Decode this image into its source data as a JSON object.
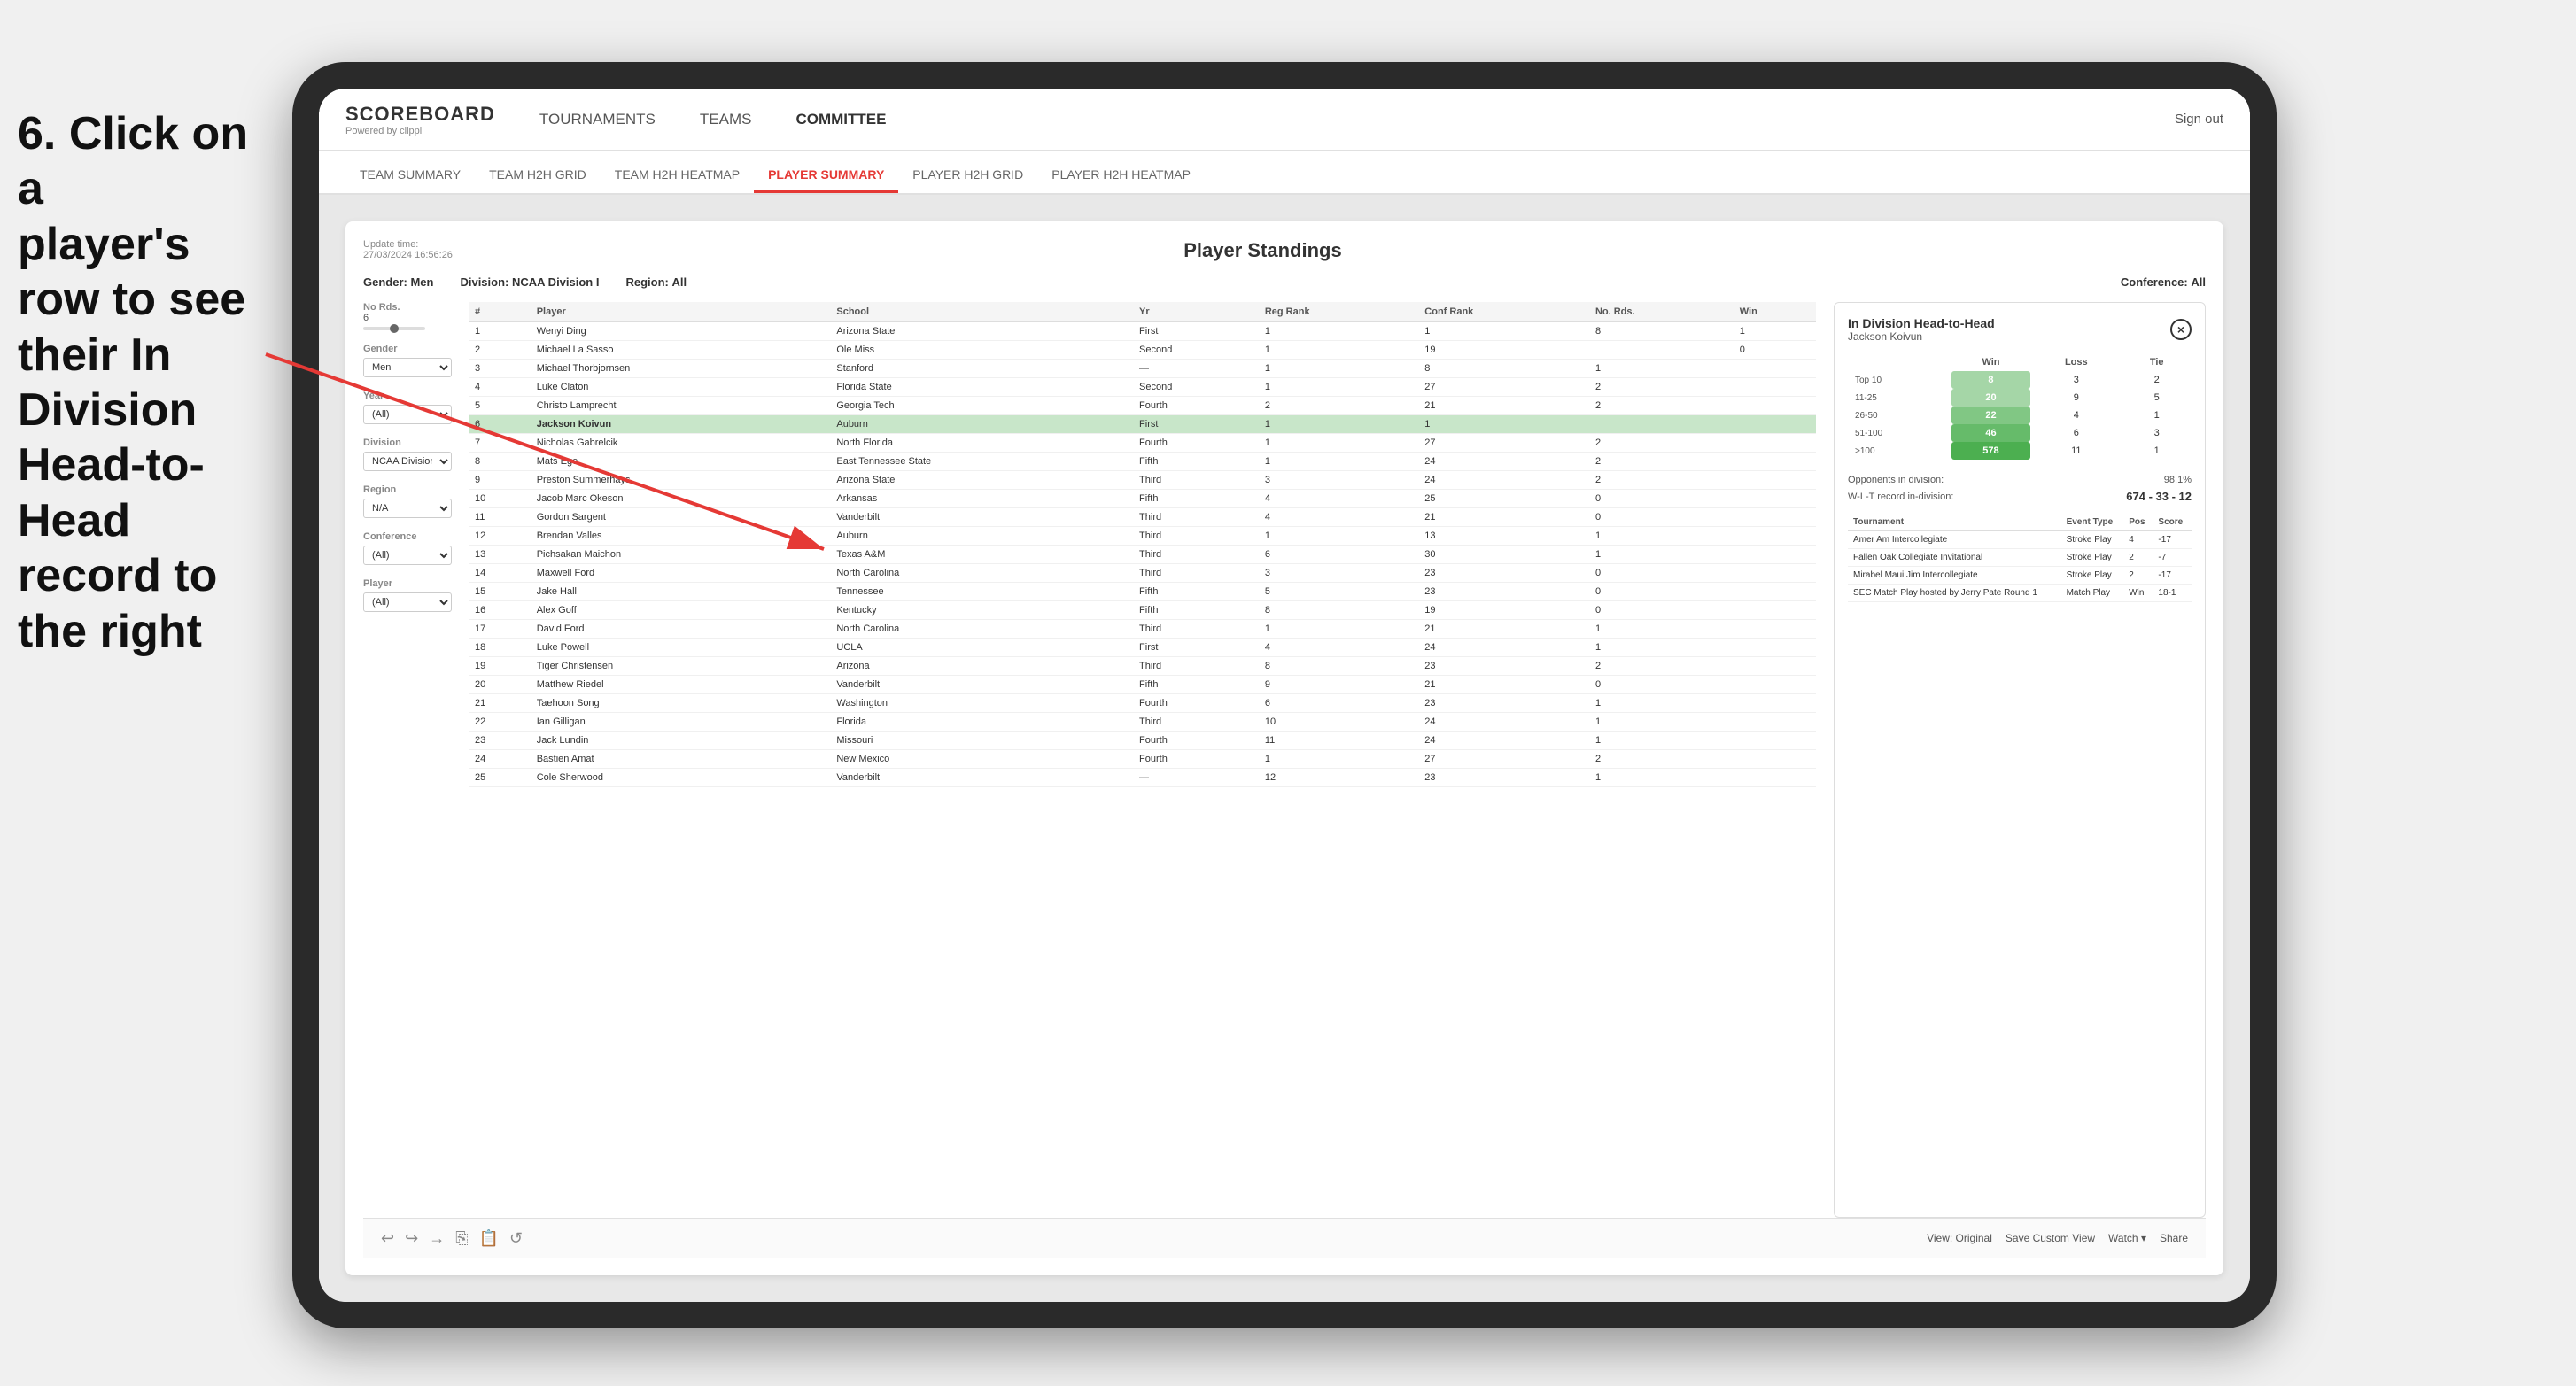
{
  "instruction": {
    "line1": "6. Click on a",
    "line2": "player's row to see",
    "line3": "their In Division",
    "line4": "Head-to-Head",
    "line5": "record to the right"
  },
  "nav": {
    "logo": "SCOREBOARD",
    "powered_by": "Powered by clippi",
    "links": [
      "TOURNAMENTS",
      "TEAMS",
      "COMMITTEE"
    ],
    "sign_out": "Sign out"
  },
  "sub_nav": {
    "items": [
      "TEAM SUMMARY",
      "TEAM H2H GRID",
      "TEAM H2H HEATMAP",
      "PLAYER SUMMARY",
      "PLAYER H2H GRID",
      "PLAYER H2H HEATMAP"
    ],
    "active": "PLAYER SUMMARY"
  },
  "dashboard": {
    "update_time_label": "Update time:",
    "update_time": "27/03/2024 16:56:26",
    "title": "Player Standings",
    "filters": {
      "gender_label": "Gender:",
      "gender": "Men",
      "division_label": "Division:",
      "division": "NCAA Division I",
      "region_label": "Region:",
      "region": "All",
      "conference_label": "Conference:",
      "conference": "All"
    },
    "sidebar": {
      "no_rds_label": "No Rds.",
      "no_rds_value": "6",
      "gender_label": "Gender",
      "gender_value": "Men",
      "year_label": "Year",
      "year_value": "(All)",
      "division_label": "Division",
      "division_value": "NCAA Division I",
      "region_label": "Region",
      "region_value": "N/A",
      "conference_label": "Conference",
      "conference_value": "(All)",
      "player_label": "Player",
      "player_value": "(All)"
    }
  },
  "table": {
    "headers": [
      "#",
      "Player",
      "School",
      "Yr",
      "Reg Rank",
      "Conf Rank",
      "No. Rds.",
      "Win"
    ],
    "rows": [
      {
        "num": "1",
        "hash": "1",
        "player": "Wenyi Ding",
        "school": "Arizona State",
        "yr": "First",
        "reg": "1",
        "conf": "1",
        "rds": "8",
        "win": "1"
      },
      {
        "num": "2",
        "hash": "2",
        "player": "Michael La Sasso",
        "school": "Ole Miss",
        "yr": "Second",
        "reg": "1",
        "conf": "19",
        "rds": "",
        "win": "0"
      },
      {
        "num": "3",
        "hash": "3",
        "player": "Michael Thorbjornsen",
        "school": "Stanford",
        "yr": "—",
        "reg": "1",
        "conf": "8",
        "rds": "1",
        "win": ""
      },
      {
        "num": "4",
        "hash": "4",
        "player": "Luke Claton",
        "school": "Florida State",
        "yr": "Second",
        "reg": "1",
        "conf": "27",
        "rds": "2",
        "win": ""
      },
      {
        "num": "5",
        "hash": "5",
        "player": "Christo Lamprecht",
        "school": "Georgia Tech",
        "yr": "Fourth",
        "reg": "2",
        "conf": "21",
        "rds": "2",
        "win": ""
      },
      {
        "num": "6",
        "hash": "6",
        "player": "Jackson Koivun",
        "school": "Auburn",
        "yr": "First",
        "reg": "1",
        "conf": "1",
        "rds": "",
        "win": ""
      },
      {
        "num": "7",
        "hash": "7",
        "player": "Nicholas Gabrelcik",
        "school": "North Florida",
        "yr": "Fourth",
        "reg": "1",
        "conf": "27",
        "rds": "2",
        "win": ""
      },
      {
        "num": "8",
        "hash": "8",
        "player": "Mats Ege",
        "school": "East Tennessee State",
        "yr": "Fifth",
        "reg": "1",
        "conf": "24",
        "rds": "2",
        "win": ""
      },
      {
        "num": "9",
        "hash": "9",
        "player": "Preston Summerhays",
        "school": "Arizona State",
        "yr": "Third",
        "reg": "3",
        "conf": "24",
        "rds": "2",
        "win": ""
      },
      {
        "num": "10",
        "hash": "10",
        "player": "Jacob Marc Okeson",
        "school": "Arkansas",
        "yr": "Fifth",
        "reg": "4",
        "conf": "25",
        "rds": "0",
        "win": ""
      },
      {
        "num": "11",
        "hash": "11",
        "player": "Gordon Sargent",
        "school": "Vanderbilt",
        "yr": "Third",
        "reg": "4",
        "conf": "21",
        "rds": "0",
        "win": ""
      },
      {
        "num": "12",
        "hash": "12",
        "player": "Brendan Valles",
        "school": "Auburn",
        "yr": "Third",
        "reg": "1",
        "conf": "13",
        "rds": "1",
        "win": ""
      },
      {
        "num": "13",
        "hash": "13",
        "player": "Pichsakan Maichon",
        "school": "Texas A&M",
        "yr": "Third",
        "reg": "6",
        "conf": "30",
        "rds": "1",
        "win": ""
      },
      {
        "num": "14",
        "hash": "14",
        "player": "Maxwell Ford",
        "school": "North Carolina",
        "yr": "Third",
        "reg": "3",
        "conf": "23",
        "rds": "0",
        "win": ""
      },
      {
        "num": "15",
        "hash": "15",
        "player": "Jake Hall",
        "school": "Tennessee",
        "yr": "Fifth",
        "reg": "5",
        "conf": "23",
        "rds": "0",
        "win": ""
      },
      {
        "num": "16",
        "hash": "16",
        "player": "Alex Goff",
        "school": "Kentucky",
        "yr": "Fifth",
        "reg": "8",
        "conf": "19",
        "rds": "0",
        "win": ""
      },
      {
        "num": "17",
        "hash": "17",
        "player": "David Ford",
        "school": "North Carolina",
        "yr": "Third",
        "reg": "1",
        "conf": "21",
        "rds": "1",
        "win": ""
      },
      {
        "num": "18",
        "hash": "18",
        "player": "Luke Powell",
        "school": "UCLA",
        "yr": "First",
        "reg": "4",
        "conf": "24",
        "rds": "1",
        "win": ""
      },
      {
        "num": "19",
        "hash": "19",
        "player": "Tiger Christensen",
        "school": "Arizona",
        "yr": "Third",
        "reg": "8",
        "conf": "23",
        "rds": "2",
        "win": ""
      },
      {
        "num": "20",
        "hash": "20",
        "player": "Matthew Riedel",
        "school": "Vanderbilt",
        "yr": "Fifth",
        "reg": "9",
        "conf": "21",
        "rds": "0",
        "win": ""
      },
      {
        "num": "21",
        "hash": "21",
        "player": "Taehoon Song",
        "school": "Washington",
        "yr": "Fourth",
        "reg": "6",
        "conf": "23",
        "rds": "1",
        "win": ""
      },
      {
        "num": "22",
        "hash": "22",
        "player": "Ian Gilligan",
        "school": "Florida",
        "yr": "Third",
        "reg": "10",
        "conf": "24",
        "rds": "1",
        "win": ""
      },
      {
        "num": "23",
        "hash": "23",
        "player": "Jack Lundin",
        "school": "Missouri",
        "yr": "Fourth",
        "reg": "11",
        "conf": "24",
        "rds": "1",
        "win": ""
      },
      {
        "num": "24",
        "hash": "24",
        "player": "Bastien Amat",
        "school": "New Mexico",
        "yr": "Fourth",
        "reg": "1",
        "conf": "27",
        "rds": "2",
        "win": ""
      },
      {
        "num": "25",
        "hash": "25",
        "player": "Cole Sherwood",
        "school": "Vanderbilt",
        "yr": "—",
        "reg": "12",
        "conf": "23",
        "rds": "1",
        "win": ""
      }
    ]
  },
  "h2h_panel": {
    "title": "In Division Head-to-Head",
    "player_name": "Jackson Koivun",
    "close_label": "×",
    "table_headers": [
      "Win",
      "Loss",
      "Tie"
    ],
    "rows": [
      {
        "range": "Top 10",
        "win": "8",
        "loss": "3",
        "tie": "2"
      },
      {
        "range": "11-25",
        "win": "20",
        "loss": "9",
        "tie": "5"
      },
      {
        "range": "26-50",
        "win": "22",
        "loss": "4",
        "tie": "1"
      },
      {
        "range": "51-100",
        "win": "46",
        "loss": "6",
        "tie": "3"
      },
      {
        "range": ">100",
        "win": "578",
        "loss": "11",
        "tie": "1"
      }
    ],
    "opponents_label": "Opponents in division:",
    "opponents_pct": "98.1%",
    "wlt_label": "W-L-T record in-division:",
    "wlt_value": "674 - 33 - 12",
    "tournament_headers": [
      "Tournament",
      "Event Type",
      "Pos",
      "Score"
    ],
    "tournaments": [
      {
        "name": "Amer Am Intercollegiate",
        "type": "Stroke Play",
        "pos": "4",
        "score": "-17"
      },
      {
        "name": "Fallen Oak Collegiate Invitational",
        "type": "Stroke Play",
        "pos": "2",
        "score": "-7"
      },
      {
        "name": "Mirabel Maui Jim Intercollegiate",
        "type": "Stroke Play",
        "pos": "2",
        "score": "-17"
      },
      {
        "name": "SEC Match Play hosted by Jerry Pate Round 1",
        "type": "Match Play",
        "pos": "Win",
        "score": "18-1"
      }
    ]
  },
  "toolbar": {
    "undo": "↩",
    "redo": "↪",
    "forward": "→",
    "view_original": "View: Original",
    "save_custom": "Save Custom View",
    "watch": "Watch ▾",
    "share": "Share"
  }
}
